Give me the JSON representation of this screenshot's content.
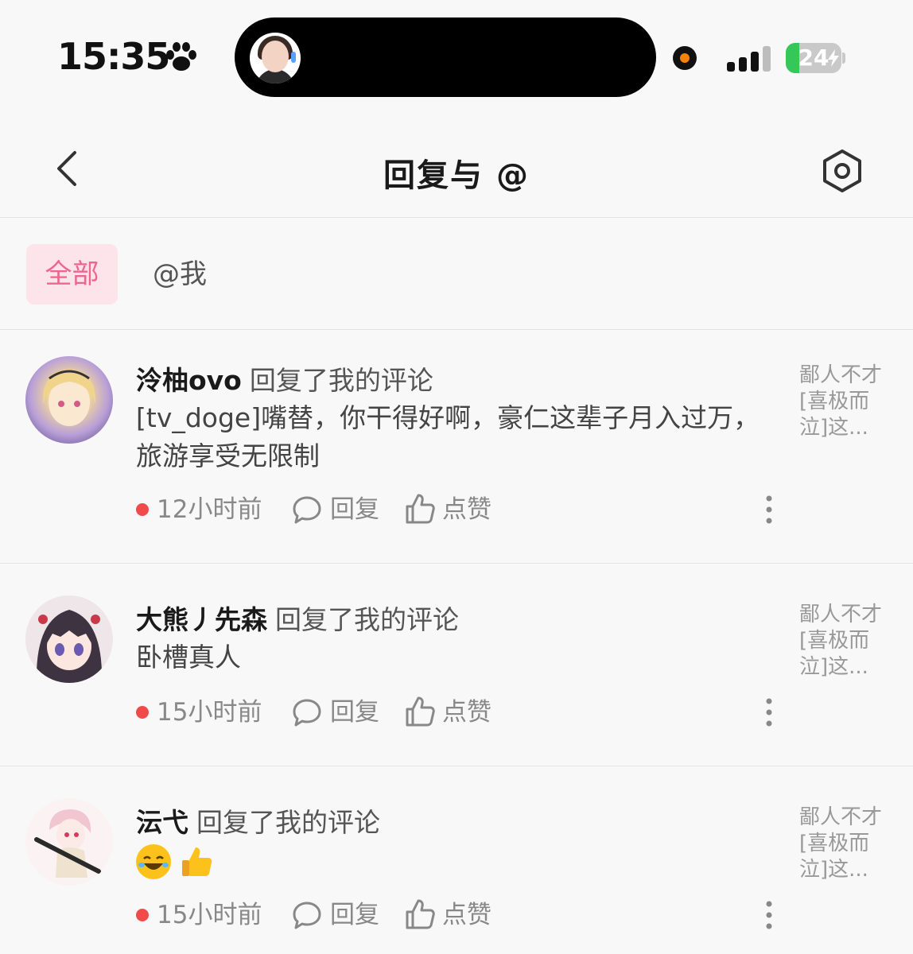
{
  "status_bar": {
    "time": "15:35",
    "battery": "24",
    "battery_level_percent": 24,
    "icons": [
      "paw-icon",
      "signal-icon",
      "battery-icon",
      "charging-icon"
    ]
  },
  "nav": {
    "title": "回复与 @",
    "back_icon": "chevron-left-icon",
    "settings_icon": "hexagon-settings-icon"
  },
  "tabs": [
    {
      "label": "全部",
      "active": true
    },
    {
      "label": "@我",
      "active": false
    }
  ],
  "colors": {
    "accent": "#f0658e",
    "accent_bg": "#fde4ea",
    "unread_dot": "#f04a4a",
    "background": "#f8f8f9"
  },
  "notifications": [
    {
      "username": "泠柚ovo",
      "action": "回复了我的评论",
      "content": "[tv_doge]嘴替，你干得好啊，豪仁这辈子月入过万，旅游享受无限制",
      "time": "12小时前",
      "reply_label": "回复",
      "like_label": "点赞",
      "quote": "鄙人不才[喜极而泣]这..."
    },
    {
      "username": "大熊丿先森",
      "action": "回复了我的评论",
      "content": "卧槽真人",
      "time": "15小时前",
      "reply_label": "回复",
      "like_label": "点赞",
      "quote": "鄙人不才[喜极而泣]这..."
    },
    {
      "username": "沄弋",
      "action": "回复了我的评论",
      "content_emojis": [
        "rofl-emoji",
        "thumbs-up-emoji"
      ],
      "time": "15小时前",
      "reply_label": "回复",
      "like_label": "点赞",
      "quote": "鄙人不才[喜极而泣]这..."
    }
  ]
}
